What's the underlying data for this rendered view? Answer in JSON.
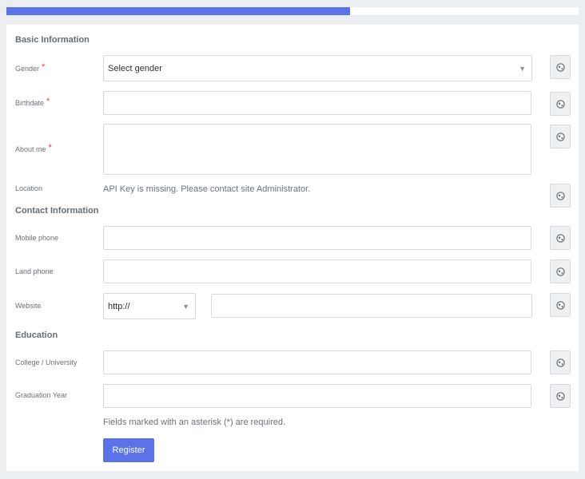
{
  "progress": {
    "fraction": 0.6
  },
  "sections": {
    "basic": "Basic Information",
    "contact": "Contact Information",
    "education": "Education"
  },
  "fields": {
    "gender": {
      "label": "Gender",
      "required_mark": "*",
      "value": "Select gender"
    },
    "birthdate": {
      "label": "Birthdate",
      "required_mark": "*"
    },
    "about": {
      "label": "About me",
      "required_mark": "*"
    },
    "location": {
      "label": "Location",
      "message": "API Key is missing. Please contact site Administrator."
    },
    "mobile": {
      "label": "Mobile phone"
    },
    "land": {
      "label": "Land phone"
    },
    "website": {
      "label": "Website",
      "protocol": "http://"
    },
    "college": {
      "label": "College / University"
    },
    "graduation": {
      "label": "Graduation Year"
    }
  },
  "note": "Fields marked with an asterisk (*) are required.",
  "register_label": "Register",
  "icons": {
    "privacy": "globe-icon",
    "dropdown": "chevron-down-icon"
  },
  "colors": {
    "accent": "#5a73ea",
    "required": "#e0413a"
  }
}
